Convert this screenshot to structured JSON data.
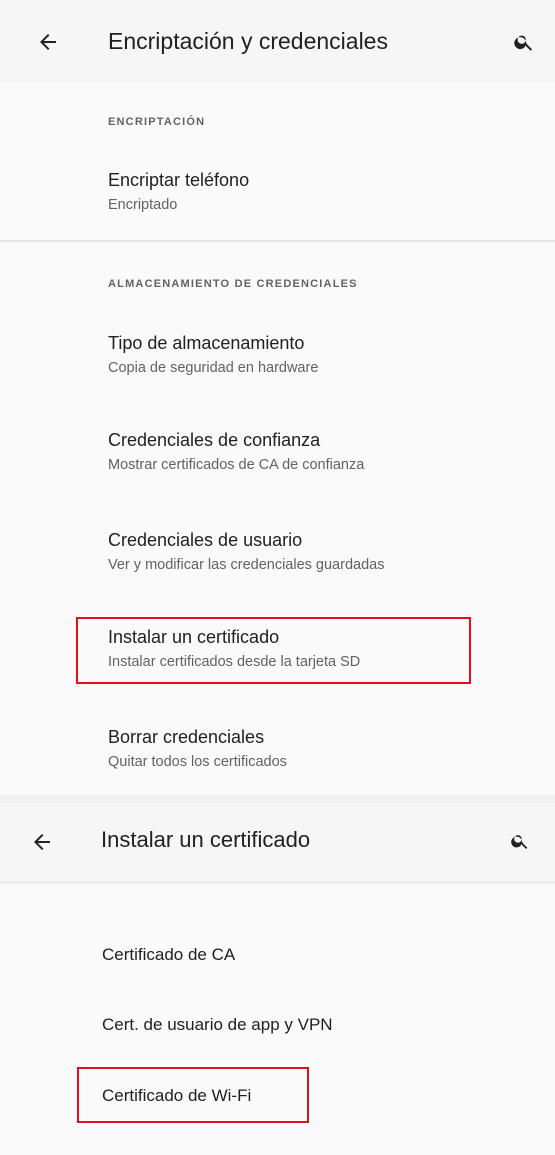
{
  "screen1": {
    "title": "Encriptación y credenciales",
    "back_icon": "arrow-left-icon",
    "search_icon": "search-icon",
    "sections": [
      {
        "header": "ENCRIPTACIÓN",
        "items": [
          {
            "title": "Encriptar teléfono",
            "summary": "Encriptado"
          }
        ]
      },
      {
        "header": "ALMACENAMIENTO DE CREDENCIALES",
        "items": [
          {
            "title": "Tipo de almacenamiento",
            "summary": "Copia de seguridad en hardware"
          },
          {
            "title": "Credenciales de confianza",
            "summary": "Mostrar certificados de CA de confianza"
          },
          {
            "title": "Credenciales de usuario",
            "summary": "Ver y modificar las credenciales guardadas"
          },
          {
            "title": "Instalar un certificado",
            "summary": "Instalar certificados desde la tarjeta SD",
            "highlighted": true
          },
          {
            "title": "Borrar credenciales",
            "summary": "Quitar todos los certificados"
          }
        ]
      }
    ]
  },
  "screen2": {
    "title": "Instalar un certificado",
    "back_icon": "arrow-left-icon",
    "search_icon": "search-icon",
    "items": [
      {
        "title": "Certificado de CA"
      },
      {
        "title": "Cert. de usuario de app y VPN"
      },
      {
        "title": "Certificado de Wi-Fi",
        "highlighted": true
      }
    ]
  },
  "colors": {
    "highlight": "#e0101c",
    "background": "#fafafa",
    "separator": "#f1f1f1"
  }
}
